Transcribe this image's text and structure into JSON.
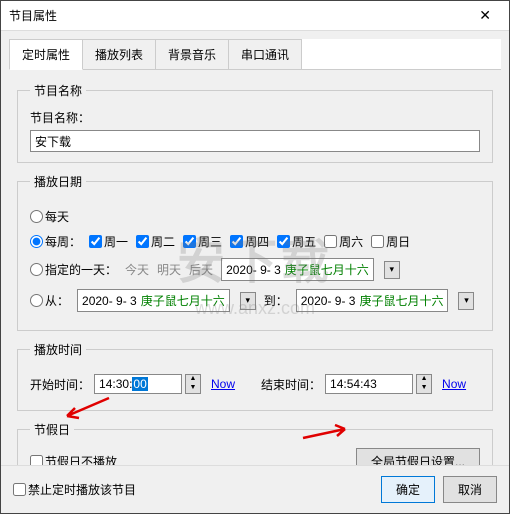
{
  "window": {
    "title": "节目属性"
  },
  "tabs": {
    "t0": "定时属性",
    "t1": "播放列表",
    "t2": "背景音乐",
    "t3": "串口通讯"
  },
  "section_name": {
    "legend": "节目名称",
    "label": "节目名称：",
    "value": "安下载"
  },
  "section_date": {
    "legend": "播放日期",
    "daily": "每天",
    "weekly": "每周：",
    "days": {
      "d1": "周一",
      "d2": "周二",
      "d3": "周三",
      "d4": "周四",
      "d5": "周五",
      "d6": "周六",
      "d7": "周日"
    },
    "specific": "指定的一天：",
    "today": "今天",
    "tomorrow": "明天",
    "aftertomorrow": "后天",
    "date1": "2020- 9- 3",
    "lunar1": "庚子鼠七月十六",
    "from": "从：",
    "date2": "2020- 9- 3",
    "lunar2": "庚子鼠七月十六",
    "to": "到：",
    "date3": "2020- 9- 3",
    "lunar3": "庚子鼠七月十六"
  },
  "section_time": {
    "legend": "播放时间",
    "start_label": "开始时间：",
    "start_h": "14",
    "start_m": "30",
    "start_s": "00",
    "now": "Now",
    "end_label": "结束时间：",
    "end_value": "14:54:43"
  },
  "section_holiday": {
    "legend": "节假日",
    "skip": "节假日不播放",
    "global_btn": "全局节假日设置..."
  },
  "footer": {
    "forbid": "禁止定时播放该节目",
    "ok": "确定",
    "cancel": "取消"
  },
  "watermark": {
    "text": "安下载",
    "url": "www.anxz.com"
  }
}
